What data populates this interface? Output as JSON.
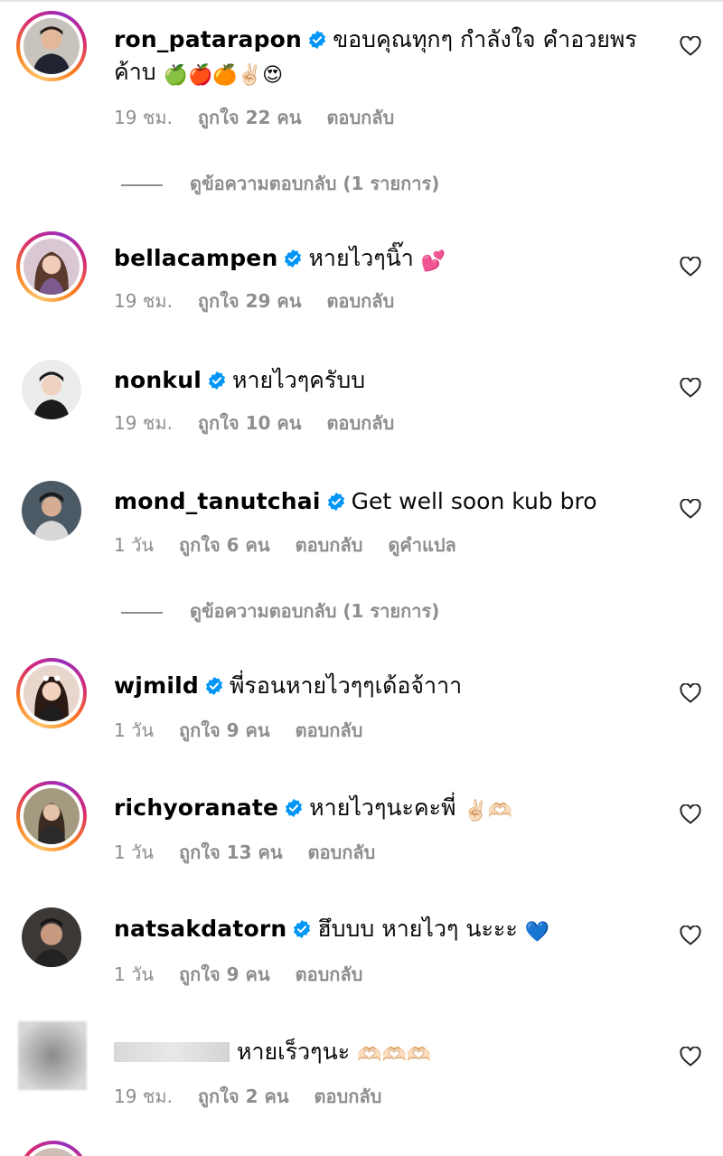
{
  "comments": [
    {
      "username": "ron_patarapon",
      "verified": true,
      "text": "ขอบคุณทุกๆ กำลังใจ คำอวยพร ค้าบ",
      "emojis": "🍏🍎🍊✌🏻😍",
      "time": "19 ชม.",
      "likes": "ถูกใจ 22 คน",
      "reply": "ตอบกลับ",
      "avatar": "story-ring",
      "view_replies": "ดูข้อความตอบกลับ (1 รายการ)"
    },
    {
      "username": "bellacampen",
      "verified": true,
      "text": "หายไวๆนิ๊า",
      "emojis": "💕",
      "time": "19 ชม.",
      "likes": "ถูกใจ 29 คน",
      "reply": "ตอบกลับ",
      "avatar": "story-ring"
    },
    {
      "username": "nonkul",
      "verified": true,
      "text": "หายไวๆครับบ",
      "time": "19 ชม.",
      "likes": "ถูกใจ 10 คน",
      "reply": "ตอบกลับ",
      "avatar": "plain"
    },
    {
      "username": "mond_tanutchai",
      "verified": true,
      "text": "Get well soon kub bro",
      "time": "1 วัน",
      "likes": "ถูกใจ 6 คน",
      "reply": "ตอบกลับ",
      "translate": "ดูคำแปล",
      "avatar": "plain",
      "view_replies": "ดูข้อความตอบกลับ (1 รายการ)"
    },
    {
      "username": "wjmild",
      "verified": true,
      "text": "พี่รอนหายไวๆๆเด้อจ้าาา",
      "time": "1 วัน",
      "likes": "ถูกใจ 9 คน",
      "reply": "ตอบกลับ",
      "avatar": "story-ring"
    },
    {
      "username": "richyoranate",
      "verified": true,
      "text": "หายไวๆนะคะพี่",
      "emojis": "✌🏻🫶🏻",
      "time": "1 วัน",
      "likes": "ถูกใจ 13 คน",
      "reply": "ตอบกลับ",
      "avatar": "story-ring"
    },
    {
      "username": "natsakdatorn",
      "verified": true,
      "text": "ฮึบบบ หายไวๆ นะะะ",
      "emojis": "💙",
      "time": "1 วัน",
      "likes": "ถูกใจ 9 คน",
      "reply": "ตอบกลับ",
      "avatar": "plain"
    },
    {
      "username": "",
      "verified": false,
      "text": "หายเร็วๆนะ",
      "emojis": "🫶🏻🫶🏻🫶🏻",
      "time": "19 ชม.",
      "likes": "ถูกใจ 2 คน",
      "reply": "ตอบกลับ",
      "avatar": "blurred"
    }
  ],
  "colors": {
    "username": "#000000",
    "meta": "#8e8e8e",
    "verified": "#0095f6",
    "ring_start": "#fdc468",
    "ring_end": "#962fbf"
  },
  "icons": {
    "like": "heart-outline-icon",
    "verified": "verified-badge-icon"
  }
}
